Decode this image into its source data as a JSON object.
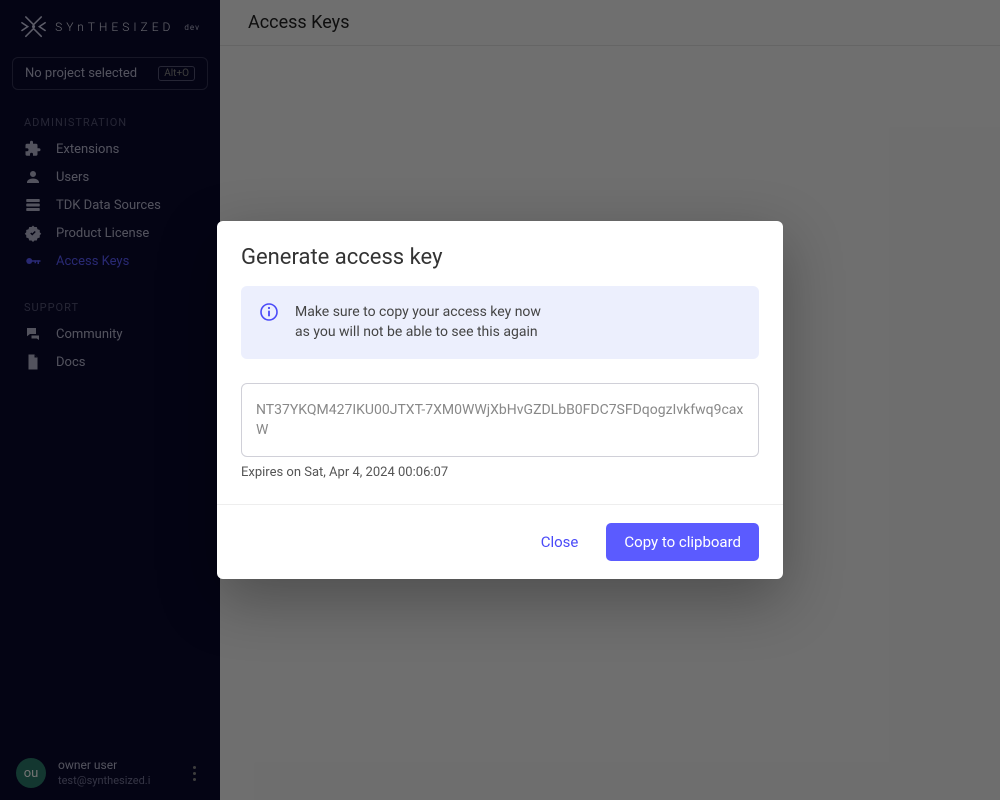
{
  "brand": {
    "name": "SYnTHESIZED",
    "sup": "dev"
  },
  "project_selector": {
    "label": "No project selected",
    "shortcut": "Alt+O"
  },
  "sidebar": {
    "sections": [
      {
        "header": "ADMINISTRATION",
        "items": [
          {
            "label": "Extensions",
            "icon": "puzzle-icon",
            "active": false
          },
          {
            "label": "Users",
            "icon": "user-icon",
            "active": false
          },
          {
            "label": "TDK Data Sources",
            "icon": "database-icon",
            "active": false
          },
          {
            "label": "Product License",
            "icon": "certificate-icon",
            "active": false
          },
          {
            "label": "Access Keys",
            "icon": "key-icon",
            "active": true
          }
        ]
      },
      {
        "header": "SUPPORT",
        "items": [
          {
            "label": "Community",
            "icon": "chat-icon",
            "active": false
          },
          {
            "label": "Docs",
            "icon": "doc-icon",
            "active": false
          }
        ]
      }
    ]
  },
  "user": {
    "initials": "ou",
    "name": "owner user",
    "email": "test@synthesized.i"
  },
  "page": {
    "title": "Access Keys"
  },
  "modal": {
    "title": "Generate access key",
    "info_line1": "Make sure to copy your access key now",
    "info_line2": "as you will not be able to see this again",
    "key_value": "NT37YKQM427IKU00JTXT-7XM0WWjXbHvGZDLbB0FDC7SFDqogzIvkfwq9caxW",
    "expiry": "Expires on Sat, Apr 4, 2024 00:06:07",
    "close_label": "Close",
    "copy_label": "Copy to clipboard"
  }
}
